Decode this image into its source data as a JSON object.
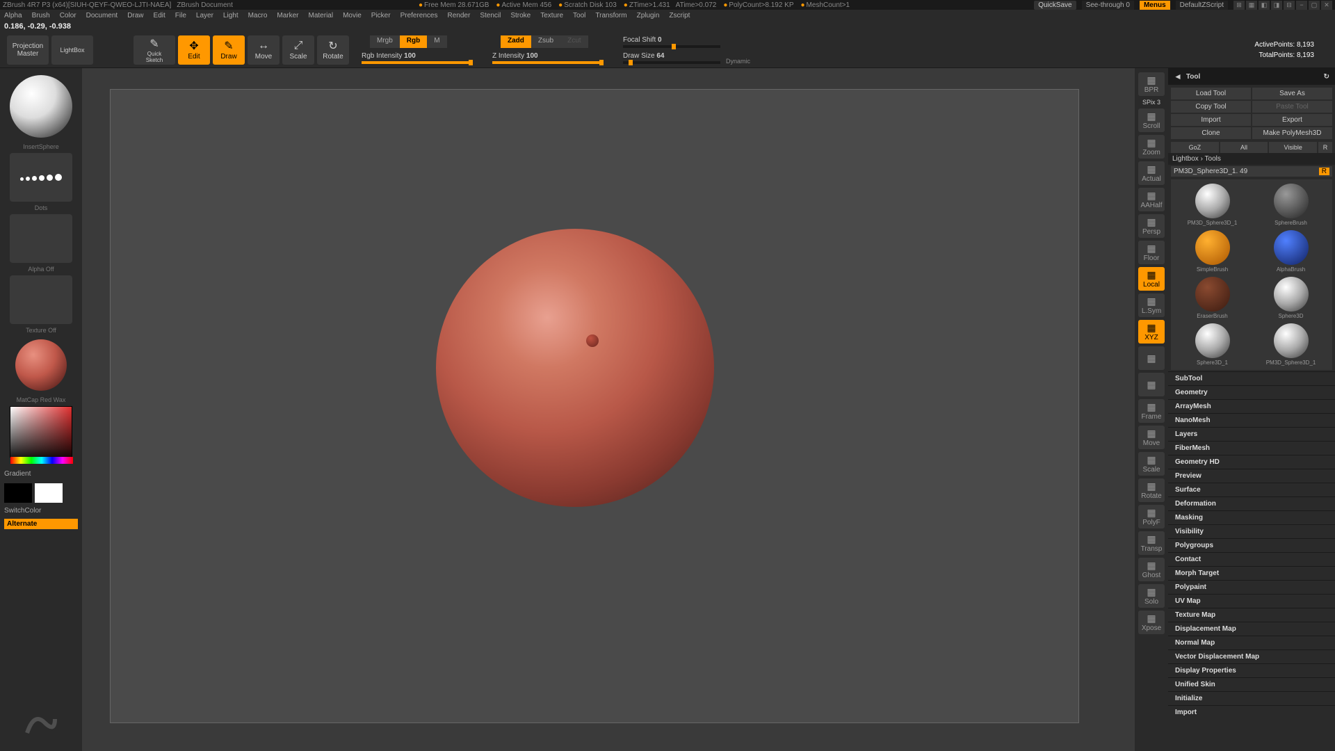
{
  "titlebar": {
    "app": "ZBrush 4R7 P3 (x64)[SIUH-QEYF-QWEO-LJTI-NAEA]",
    "doc": "ZBrush Document",
    "freemem": "Free Mem 28.671GB",
    "activemem": "Active Mem 456",
    "scratch": "Scratch Disk 103",
    "ztime": "ZTime>1.431",
    "atime": "ATime>0.072",
    "polycount": "PolyCount>8.192 KP",
    "meshcount": "MeshCount>1",
    "quicksave": "QuickSave",
    "seethrough": "See-through  0",
    "menus": "Menus",
    "script": "DefaultZScript"
  },
  "menubar": [
    "Alpha",
    "Brush",
    "Color",
    "Document",
    "Draw",
    "Edit",
    "File",
    "Layer",
    "Light",
    "Macro",
    "Marker",
    "Material",
    "Movie",
    "Picker",
    "Preferences",
    "Render",
    "Stencil",
    "Stroke",
    "Texture",
    "Tool",
    "Transform",
    "Zplugin",
    "Zscript"
  ],
  "coords": "0.186, -0.29, -0.938",
  "toolbar": {
    "projection": "Projection\nMaster",
    "lightbox": "LightBox",
    "quicksketch": "Quick\nSketch",
    "edit": "Edit",
    "draw": "Draw",
    "move": "Move",
    "scale": "Scale",
    "rotate": "Rotate",
    "mrgb": "Mrgb",
    "rgb": "Rgb",
    "m": "M",
    "rgbintensity_label": "Rgb Intensity",
    "rgbintensity_val": "100",
    "zadd": "Zadd",
    "zsub": "Zsub",
    "zcut": "Zcut",
    "zintensity_label": "Z Intensity",
    "zintensity_val": "100",
    "focalshift_label": "Focal Shift",
    "focalshift_val": "0",
    "drawsize_label": "Draw Size",
    "drawsize_val": "64",
    "dynamic": "Dynamic",
    "activepoints_label": "ActivePoints:",
    "activepoints_val": "8,193",
    "totalpoints_label": "TotalPoints:",
    "totalpoints_val": "8,193"
  },
  "left": {
    "brush": "InsertSphere",
    "stroke": "Dots",
    "alpha": "Alpha Off",
    "texture": "Texture Off",
    "material": "MatCap Red Wax",
    "gradient": "Gradient",
    "switchcolor": "SwitchColor",
    "alternate": "Alternate"
  },
  "rightbar": {
    "spix": "SPix 3",
    "items": [
      "BPR",
      "Scroll",
      "Zoom",
      "Actual",
      "AAHalf",
      "Persp",
      "Floor",
      "Local",
      "L.Sym",
      "XYZ",
      "",
      "",
      "Frame",
      "Move",
      "Scale",
      "Rotate",
      "PolyF",
      "Transp",
      "Ghost",
      "Solo",
      "Xpose"
    ]
  },
  "tool": {
    "header": "Tool",
    "loadtool": "Load Tool",
    "saveas": "Save As",
    "copytool": "Copy Tool",
    "pastetool": "Paste Tool",
    "import": "Import",
    "export": "Export",
    "clone": "Clone",
    "makepolymesh": "Make PolyMesh3D",
    "goz": "GoZ",
    "all": "All",
    "visible": "Visible",
    "r": "R",
    "lightboxtools": "Lightbox › Tools",
    "toolname": "PM3D_Sphere3D_1. 49",
    "r2": "R",
    "brushes": [
      {
        "name": "PM3D_Sphere3D_1",
        "bg": "radial-gradient(circle at 35% 30%,#fff,#aaa 50%,#333)"
      },
      {
        "name": "SphereBrush",
        "bg": "radial-gradient(circle at 35% 30%,#999,#222)"
      },
      {
        "name": "SimpleBrush",
        "bg": "radial-gradient(circle at 35% 30%,#ffb030,#aa5500)"
      },
      {
        "name": "AlphaBrush",
        "bg": "radial-gradient(circle at 35% 30%,#5080ff,#102060)"
      },
      {
        "name": "EraserBrush",
        "bg": "radial-gradient(circle at 35% 30%,#8a4a30,#3a1a10)"
      },
      {
        "name": "Sphere3D",
        "bg": "radial-gradient(circle at 35% 30%,#fff,#aaa 50%,#333)"
      },
      {
        "name": "Sphere3D_1",
        "bg": "radial-gradient(circle at 35% 30%,#fff,#aaa 50%,#333)"
      },
      {
        "name": "PM3D_Sphere3D_1",
        "bg": "radial-gradient(circle at 35% 30%,#fff,#aaa 50%,#333)"
      }
    ],
    "sections": [
      "SubTool",
      "Geometry",
      "ArrayMesh",
      "NanoMesh",
      "Layers",
      "FiberMesh",
      "Geometry HD",
      "Preview",
      "Surface",
      "Deformation",
      "Masking",
      "Visibility",
      "Polygroups",
      "Contact",
      "Morph Target",
      "Polypaint",
      "UV Map",
      "Texture Map",
      "Displacement Map",
      "Normal Map",
      "Vector Displacement Map",
      "Display Properties",
      "Unified Skin",
      "Initialize",
      "Import"
    ]
  }
}
